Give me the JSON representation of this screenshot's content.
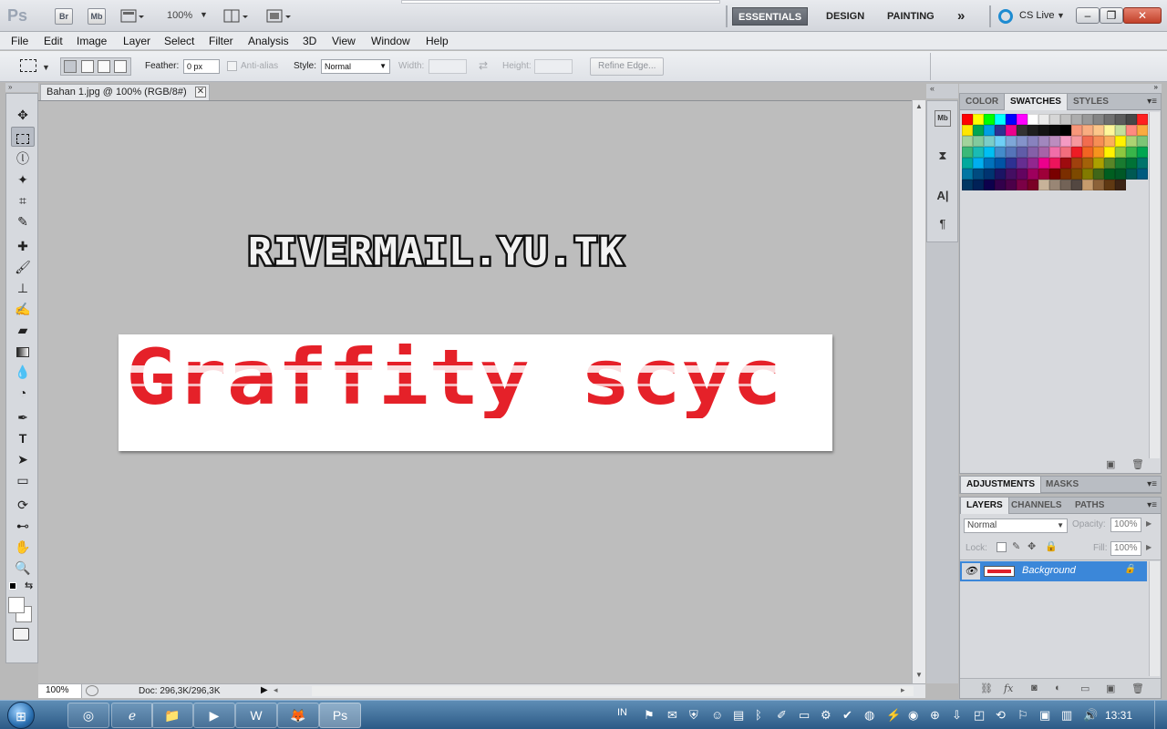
{
  "app": {
    "logo": "Ps",
    "bridge_label": "Br",
    "minibridge_label": "Mb",
    "zoom": "100%",
    "workspaces": [
      "ESSENTIALS",
      "DESIGN",
      "PAINTING"
    ],
    "more_workspaces": "»",
    "cslive": "CS Live"
  },
  "menu": [
    "File",
    "Edit",
    "Image",
    "Layer",
    "Select",
    "Filter",
    "Analysis",
    "3D",
    "View",
    "Window",
    "Help"
  ],
  "options": {
    "feather_label": "Feather:",
    "feather_value": "0 px",
    "antialias_label": "Anti-alias",
    "style_label": "Style:",
    "style_value": "Normal",
    "width_label": "Width:",
    "height_label": "Height:",
    "refine_label": "Refine Edge..."
  },
  "document": {
    "tab_title": "Bahan 1.jpg @ 100% (RGB/8#)",
    "watermark": "RIVERMAIL.YU.TK",
    "banner_text": "Graffity scyc",
    "zoom_field": "100%",
    "doc_info": "Doc: 296,3K/296,3K"
  },
  "panels": {
    "color_tabs": [
      "COLOR",
      "SWATCHES",
      "STYLES"
    ],
    "active_color_tab": "SWATCHES",
    "adjust_tabs": [
      "ADJUSTMENTS",
      "MASKS"
    ],
    "layer_tabs": [
      "LAYERS",
      "CHANNELS",
      "PATHS"
    ],
    "blend_mode": "Normal",
    "opacity_label": "Opacity:",
    "opacity_value": "100%",
    "lock_label": "Lock:",
    "fill_label": "Fill:",
    "fill_value": "100%",
    "layer_name": "Background",
    "swatches": [
      "#ff0000",
      "#ffff00",
      "#00ff00",
      "#00ffff",
      "#0000ff",
      "#ff00ff",
      "#ffffff",
      "#ebebeb",
      "#d6d6d6",
      "#c2c2c2",
      "#adadad",
      "#999999",
      "#858585",
      "#707070",
      "#5c5c5c",
      "#474747",
      "#ff2020",
      "#ffe600",
      "#00a651",
      "#00a0e3",
      "#2e3192",
      "#ec008c",
      "#333333",
      "#1f1f1f",
      "#141414",
      "#0a0a0a",
      "#000000",
      "#f7977a",
      "#f9ad81",
      "#fdc68a",
      "#fff79a",
      "#c4df9b",
      "#ff8a80",
      "#fbab3f",
      "#a2d39c",
      "#82ca9d",
      "#7bcdc8",
      "#6ecff6",
      "#7ea7d8",
      "#8493ca",
      "#8882be",
      "#a187be",
      "#bc8dbf",
      "#f49ac2",
      "#f6989d",
      "#f26c4f",
      "#f68e55",
      "#fbaf5c",
      "#fff200",
      "#acd372",
      "#7cc576",
      "#3bb878",
      "#1abbb4",
      "#00bff3",
      "#438ccb",
      "#5574b9",
      "#605ca8",
      "#855fa8",
      "#a763a8",
      "#f06ea9",
      "#f26d7d",
      "#ed1c24",
      "#f26522",
      "#f7941d",
      "#fff200",
      "#8dc73f",
      "#39b54a",
      "#00a651",
      "#00a99d",
      "#00aeef",
      "#0072bc",
      "#0054a6",
      "#2e3192",
      "#662d91",
      "#92278f",
      "#ec008c",
      "#ed145b",
      "#9e0b0f",
      "#a0410d",
      "#a36209",
      "#aba000",
      "#598527",
      "#197b30",
      "#007236",
      "#00746b",
      "#0076a3",
      "#004b80",
      "#003471",
      "#1b1464",
      "#440e62",
      "#630460",
      "#9e005d",
      "#9e0039",
      "#790000",
      "#7b2e00",
      "#7d4900",
      "#827b00",
      "#406618",
      "#005e20",
      "#005826",
      "#005952",
      "#005b7f",
      "#003663",
      "#002157",
      "#0d004c",
      "#32004b",
      "#4b0049",
      "#7b0046",
      "#7a0026",
      "#c7b299",
      "#998675",
      "#736357",
      "#534741",
      "#c69c6d",
      "#8c6239",
      "#603913",
      "#3c2415"
    ]
  },
  "taskbar": {
    "language": "IN",
    "time": "13:31"
  }
}
